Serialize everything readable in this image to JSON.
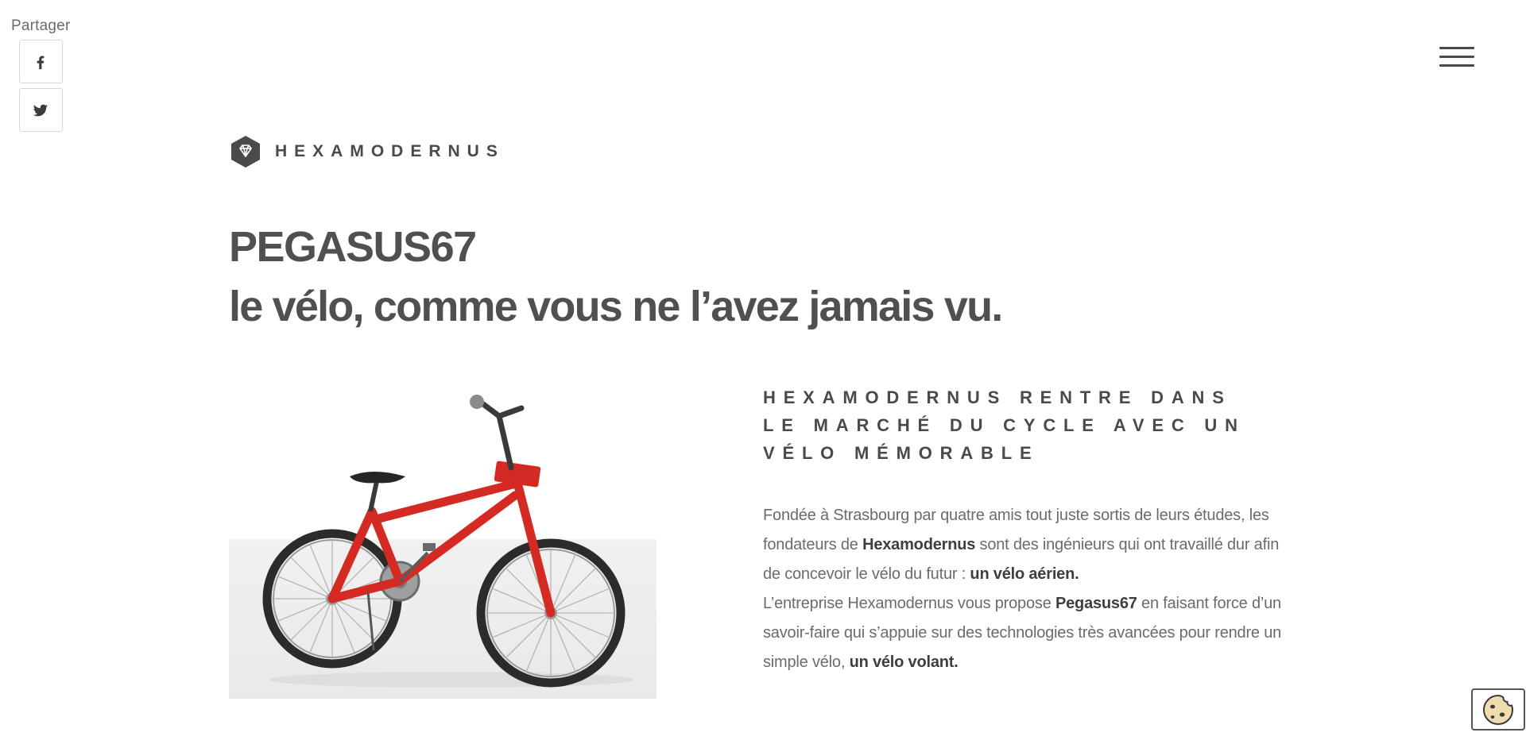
{
  "share": {
    "label": "Partager",
    "buttons": [
      {
        "name": "facebook",
        "icon": "facebook-icon"
      },
      {
        "name": "twitter",
        "icon": "twitter-icon"
      }
    ]
  },
  "nav": {
    "menu_icon": "hamburger-menu-icon"
  },
  "brand": {
    "name": "HEXAMODERNUS",
    "logo_icon": "diamond-hexagon-logo"
  },
  "hero": {
    "title": "PEGASUS67",
    "subtitle": "le vélo, comme vous ne l’avez jamais vu.",
    "image_icon": "red-bmx-bicycle-image"
  },
  "article": {
    "heading": "HEXAMODERNUS RENTRE DANS LE MARCHÉ DU CYCLE AVEC UN VÉLO MÉMORABLE",
    "p1_a": "Fondée à Strasbourg par quatre amis tout juste sortis de leurs études, les fondateurs de ",
    "p1_b": "Hexamodernus",
    "p1_c": " sont des ingénieurs qui ont travaillé dur afin de concevoir le vélo du futur : ",
    "p1_d": "un vélo aérien.",
    "p2_a": "L’entreprise Hexamodernus vous propose ",
    "p2_b": "Pegasus67",
    "p2_c": " en faisant force d’un savoir-faire qui s’appuie sur des technologies très avancées pour rendre un simple vélo, ",
    "p2_d": "un vélo volant."
  },
  "cookie": {
    "icon": "cookie-icon"
  },
  "colors": {
    "text_dark": "#4a4a4a",
    "text_body": "#6b6b6b",
    "bike_red": "#d52a23"
  }
}
